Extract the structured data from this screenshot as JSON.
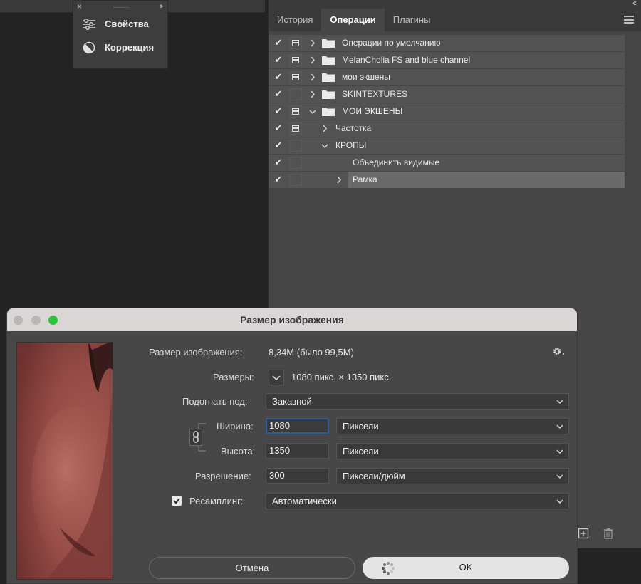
{
  "mini_panel": {
    "close": "×",
    "expand": "››",
    "items": [
      {
        "label": "Свойства",
        "icon": "sliders-icon"
      },
      {
        "label": "Коррекция",
        "icon": "adjustment-circle-icon"
      }
    ]
  },
  "actions_panel": {
    "collapse": "‹‹",
    "tabs": [
      {
        "label": "История",
        "active": false
      },
      {
        "label": "Операции",
        "active": true
      },
      {
        "label": "Плагины",
        "active": false
      }
    ],
    "rows": [
      {
        "label": "Операции по умолчанию",
        "checked": true,
        "dialog": true,
        "level": 0,
        "expanded": false,
        "folder": true
      },
      {
        "label": "MelanCholia FS and blue channel",
        "checked": true,
        "dialog": true,
        "level": 0,
        "expanded": false,
        "folder": true
      },
      {
        "label": "мои экшены",
        "checked": true,
        "dialog": true,
        "level": 0,
        "expanded": false,
        "folder": true
      },
      {
        "label": "SKINTEXTURES",
        "checked": true,
        "dialog": false,
        "level": 0,
        "expanded": false,
        "folder": true
      },
      {
        "label": "МОИ ЭКШЕНЫ",
        "checked": true,
        "dialog": true,
        "level": 0,
        "expanded": true,
        "folder": true
      },
      {
        "label": "Частотка",
        "checked": true,
        "dialog": true,
        "level": 1,
        "expanded": false,
        "folder": false
      },
      {
        "label": "КРОПЫ",
        "checked": true,
        "dialog": false,
        "level": 1,
        "expanded": true,
        "folder": false
      },
      {
        "label": "Объединить видимые",
        "checked": true,
        "dialog": false,
        "level": 2,
        "expanded": null,
        "folder": false
      },
      {
        "label": "Рамка",
        "checked": true,
        "dialog": false,
        "level": 2,
        "expanded": false,
        "folder": false,
        "selected": true
      }
    ]
  },
  "dialog": {
    "title": "Размер изображения",
    "image_size_label": "Размер изображения:",
    "image_size_value": "8,34M (было 99,5M)",
    "dimensions_label": "Размеры:",
    "dimensions_value": "1080 пикс.  ×  1350 пикс.",
    "fit_label": "Подогнать под:",
    "fit_value": "Заказной",
    "width_label": "Ширина:",
    "width_value": "1080",
    "width_unit": "Пиксели",
    "height_label": "Высота:",
    "height_value": "1350",
    "height_unit": "Пиксели",
    "resolution_label": "Разрешение:",
    "resolution_value": "300",
    "resolution_unit": "Пиксели/дюйм",
    "resample_label": "Ресамплинг:",
    "resample_checked": true,
    "resample_value": "Автоматически",
    "cancel_label": "Отмена",
    "ok_label": "OK"
  }
}
